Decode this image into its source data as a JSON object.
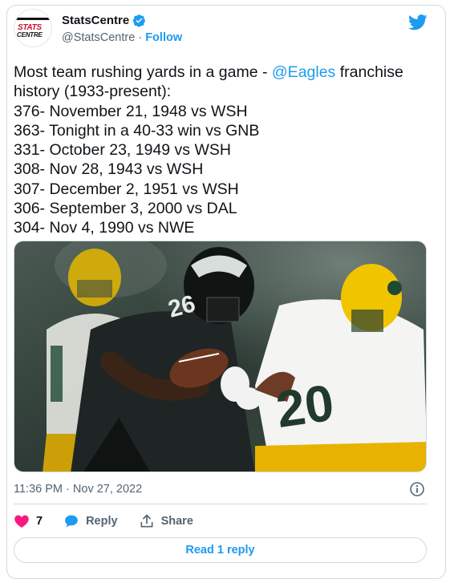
{
  "account": {
    "name": "StatsCentre",
    "handle": "@StatsCentre",
    "separator": "·",
    "follow_label": "Follow",
    "avatar_text_top": "STATS",
    "avatar_text_bottom": "CENTRE",
    "verified_icon": "verified-badge-icon"
  },
  "brand_icon": "twitter-bird-icon",
  "tweet": {
    "intro_before_mention": "Most team rushing yards in a game - ",
    "mention": "@Eagles",
    "intro_after_mention": " franchise history (1933-present):",
    "lines": [
      "376- November 21, 1948 vs WSH",
      "363- Tonight in a 40-33 win vs GNB",
      "331- October 23, 1949 vs WSH",
      "308- Nov 28, 1943 vs WSH",
      "307- December 2, 1951 vs WSH",
      "306- September 3, 2000 vs DAL",
      "304- Nov 4, 1990 vs NWE"
    ],
    "photo_numbers": {
      "eagles_player": "26",
      "packers_player": "20"
    }
  },
  "meta": {
    "time": "11:36 PM",
    "separator": "·",
    "date": "Nov 27, 2022"
  },
  "actions": {
    "like_count": "7",
    "reply_label": "Reply",
    "share_label": "Share"
  },
  "read_replies_label": "Read 1 reply",
  "colors": {
    "accent": "#1d9bf0",
    "like": "#f91880",
    "text": "#0f1419",
    "muted": "#536471",
    "border": "#cfd9de"
  }
}
